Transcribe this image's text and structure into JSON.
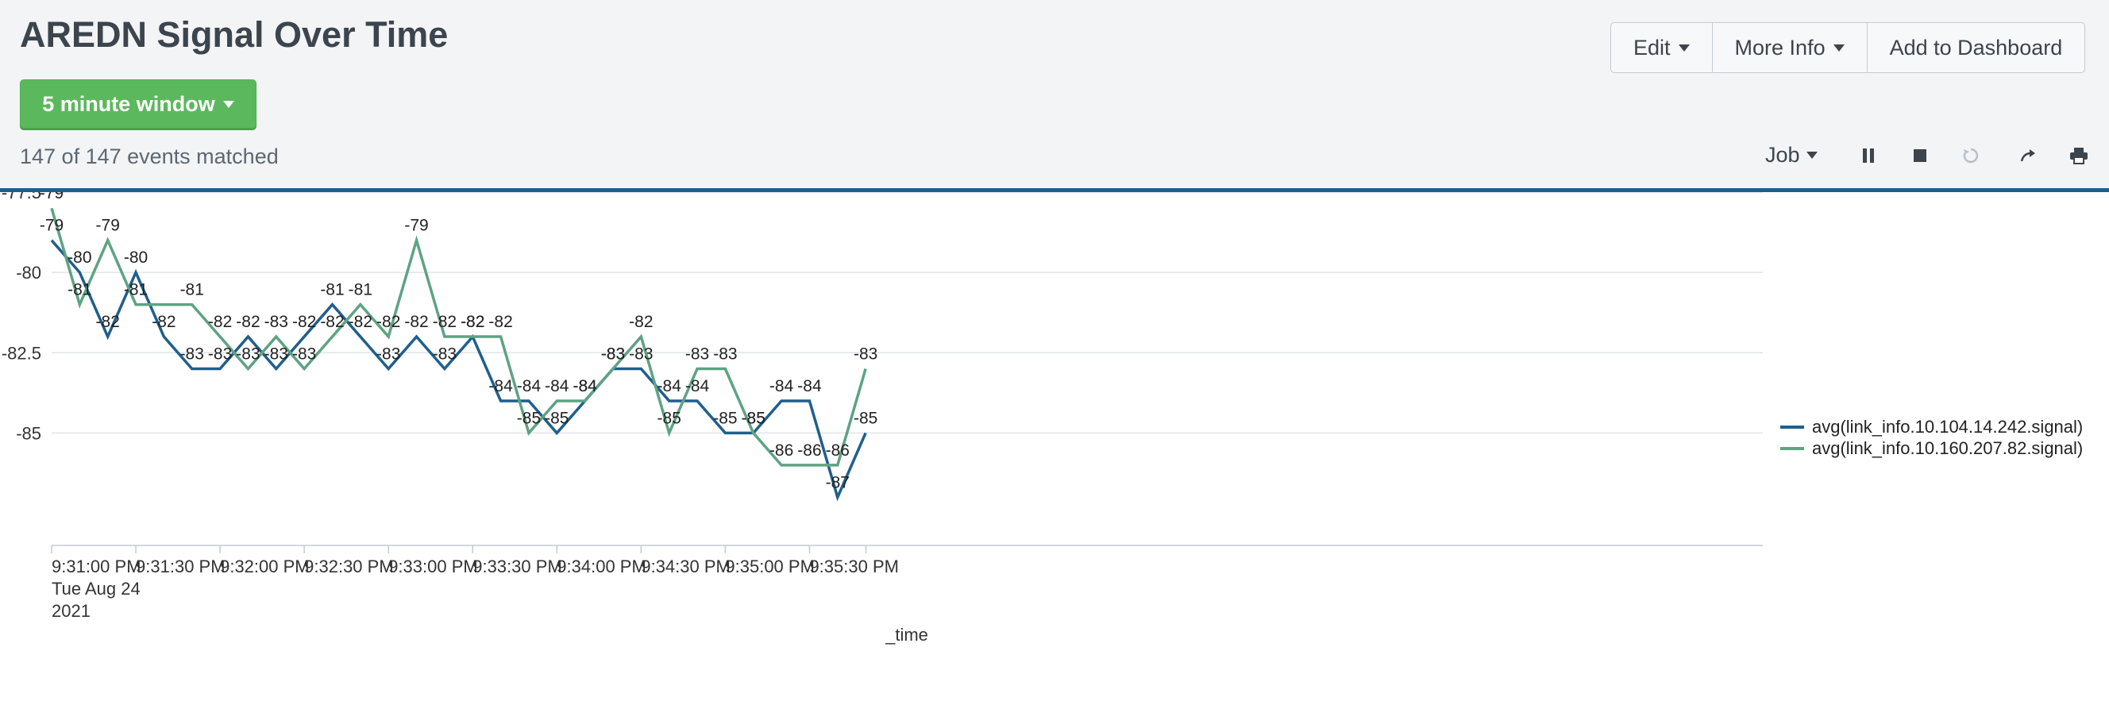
{
  "page": {
    "title": "AREDN Signal Over Time",
    "time_window_label": "5 minute window",
    "events_matched": "147 of 147 events matched"
  },
  "toolbar": {
    "edit_label": "Edit",
    "more_info_label": "More Info",
    "add_dashboard_label": "Add to Dashboard",
    "job_label": "Job",
    "icons": [
      "pause-icon",
      "stop-icon",
      "refresh-icon",
      "share-icon",
      "print-icon"
    ]
  },
  "colors": {
    "series1": "#1f5f8c",
    "series2": "#5ea383",
    "accent_green": "#5cb85c",
    "divider": "#1e5f8c"
  },
  "chart_data": {
    "type": "line",
    "xlabel": "_time",
    "ylabel": "",
    "ylim": [
      -88.5,
      -77.5
    ],
    "y_ticks": [
      "-77.5",
      "-80",
      "-82.5",
      "-85"
    ],
    "x_ticks": [
      {
        "line1": "9:31:00 PM",
        "line2": "Tue Aug 24",
        "line3": "2021"
      },
      {
        "line1": "9:31:30 PM"
      },
      {
        "line1": "9:32:00 PM"
      },
      {
        "line1": "9:32:30 PM"
      },
      {
        "line1": "9:33:00 PM"
      },
      {
        "line1": "9:33:30 PM"
      },
      {
        "line1": "9:34:00 PM"
      },
      {
        "line1": "9:34:30 PM"
      },
      {
        "line1": "9:35:00 PM"
      },
      {
        "line1": "9:35:30 PM"
      }
    ],
    "x": [
      "9:31:00 PM",
      "9:31:10 PM",
      "9:31:20 PM",
      "9:31:30 PM",
      "9:31:40 PM",
      "9:31:50 PM",
      "9:32:00 PM",
      "9:32:10 PM",
      "9:32:20 PM",
      "9:32:30 PM",
      "9:32:40 PM",
      "9:32:50 PM",
      "9:33:00 PM",
      "9:33:10 PM",
      "9:33:20 PM",
      "9:33:30 PM",
      "9:33:40 PM",
      "9:33:50 PM",
      "9:34:00 PM",
      "9:34:10 PM",
      "9:34:20 PM",
      "9:34:30 PM",
      "9:34:40 PM",
      "9:34:50 PM",
      "9:35:00 PM",
      "9:35:10 PM",
      "9:35:20 PM",
      "9:35:30 PM",
      "9:35:40 PM",
      "9:35:50 PM"
    ],
    "legend_position": "right",
    "grid": true,
    "series": [
      {
        "name": "avg(link_info.10.104.14.242.signal)",
        "values": [
          -79,
          -80,
          -82,
          -80,
          -82,
          -83,
          -83,
          -82,
          -83,
          -82,
          -81,
          -82,
          -83,
          -82,
          -83,
          -82,
          -84,
          -84,
          -85,
          -84,
          -83,
          -83,
          -84,
          -84,
          -85,
          -85,
          -84,
          -84,
          -87,
          -85
        ],
        "data_labels": [
          "-79",
          "-80",
          "-82",
          "-80",
          "-82",
          "-83",
          "-83",
          "-82",
          "-83",
          "-82",
          "-81",
          "-82",
          "-83",
          "-82",
          "-83",
          "-82",
          "-84",
          "-84",
          "-85",
          "-84",
          "-83",
          "-83",
          "-84",
          "-84",
          "-85",
          "-85",
          "-84",
          "-84",
          "-87",
          "-85"
        ]
      },
      {
        "name": "avg(link_info.10.160.207.82.signal)",
        "values": [
          -78,
          -81,
          -79,
          -81,
          -81,
          -81,
          -82,
          -83,
          -82,
          -83,
          -82,
          -81,
          -82,
          -79,
          -82,
          -82,
          -82,
          -85,
          -84,
          -84,
          -83,
          -82,
          -85,
          -83,
          -83,
          -85,
          -86,
          -86,
          -86,
          -83
        ],
        "data_labels": [
          "-79",
          "-81",
          "-79",
          "-81",
          "",
          "-81",
          "-82",
          "-83",
          "-83",
          "-83",
          "-82",
          "-81",
          "-82",
          "-79",
          "-82",
          "-82",
          "-82",
          "-85",
          "-84",
          "-84",
          "-83",
          "-82",
          "-85",
          "-83",
          "-83",
          "-85",
          "-86",
          "-86",
          "-86",
          "-83"
        ]
      }
    ]
  }
}
